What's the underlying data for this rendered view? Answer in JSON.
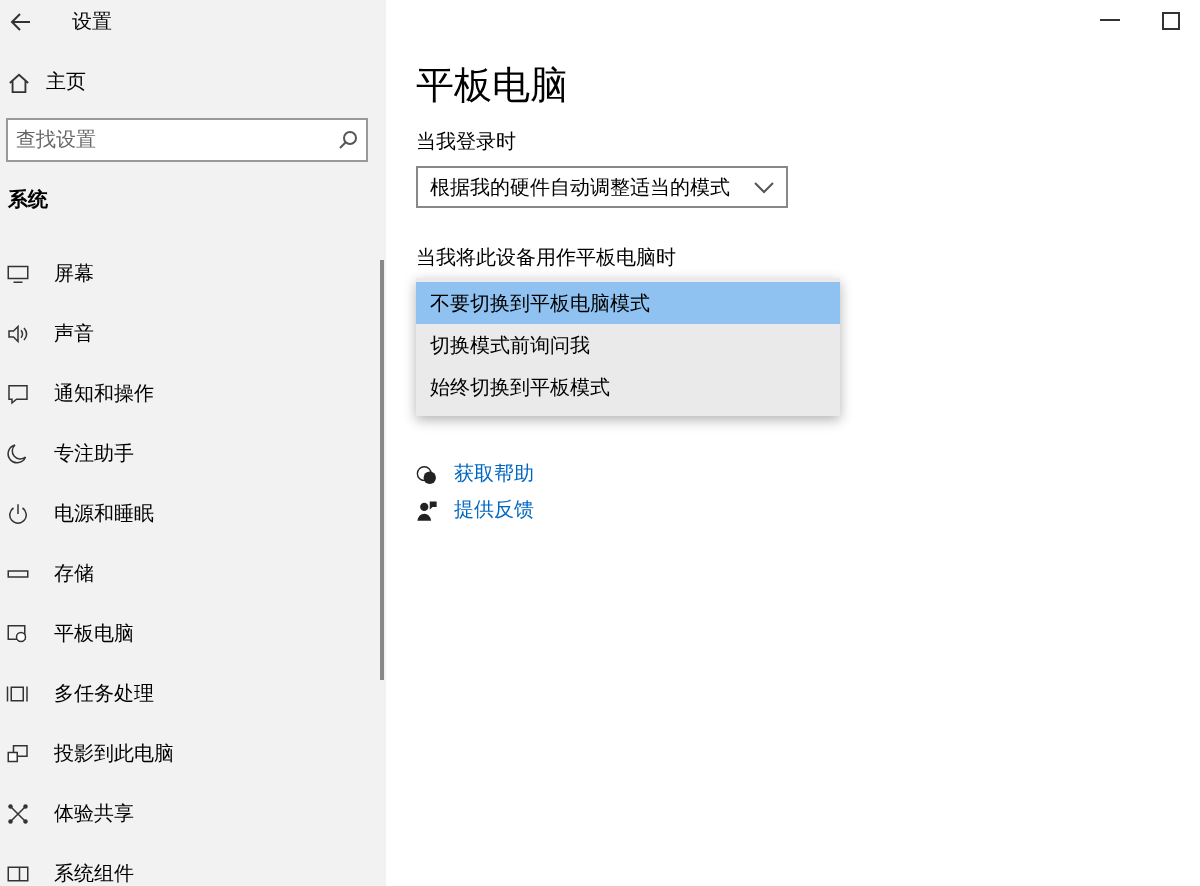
{
  "window": {
    "title": "设置"
  },
  "sidebar": {
    "home": "主页",
    "search": {
      "placeholder": "查找设置"
    },
    "section": "系统",
    "items": [
      {
        "label": "屏幕"
      },
      {
        "label": "声音"
      },
      {
        "label": "通知和操作"
      },
      {
        "label": "专注助手"
      },
      {
        "label": "电源和睡眠"
      },
      {
        "label": "存储"
      },
      {
        "label": "平板电脑"
      },
      {
        "label": "多任务处理"
      },
      {
        "label": "投影到此电脑"
      },
      {
        "label": "体验共享"
      },
      {
        "label": "系统组件"
      }
    ]
  },
  "page": {
    "title": "平板电脑",
    "signin": {
      "label": "当我登录时",
      "value": "根据我的硬件自动调整适当的模式"
    },
    "tablet_use": {
      "label": "当我将此设备用作平板电脑时",
      "options": [
        {
          "label": "不要切换到平板电脑模式",
          "selected": true
        },
        {
          "label": "切换模式前询问我",
          "selected": false
        },
        {
          "label": "始终切换到平板模式",
          "selected": false
        }
      ]
    },
    "links": [
      {
        "label": "获取帮助"
      },
      {
        "label": "提供反馈"
      }
    ]
  }
}
